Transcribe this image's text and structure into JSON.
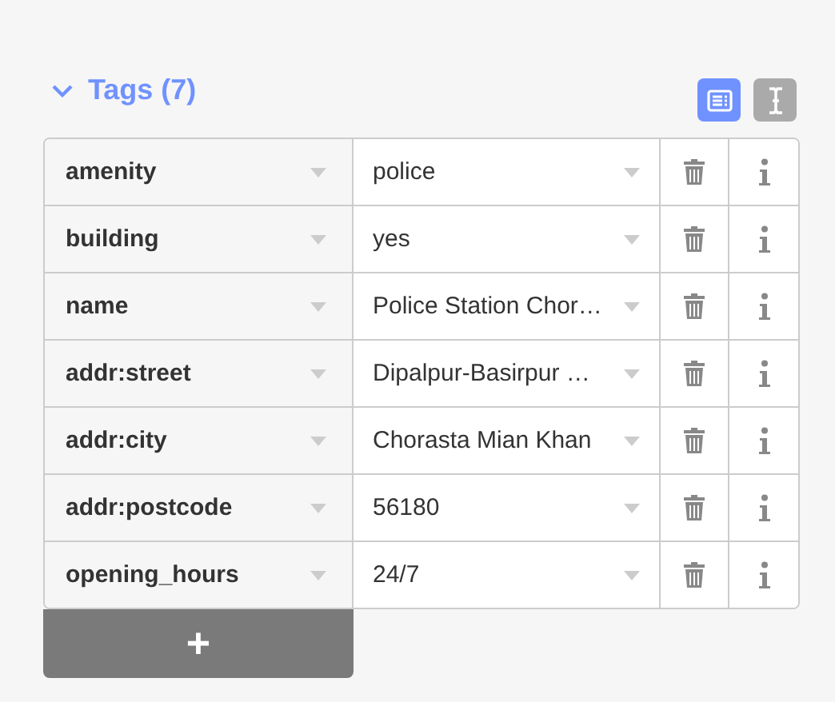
{
  "section": {
    "title": "Tags (7)",
    "expanded": true
  },
  "view_toggles": [
    {
      "kind": "list",
      "selected": true
    },
    {
      "kind": "text",
      "selected": false
    }
  ],
  "tags": [
    {
      "key": "amenity",
      "value": "police"
    },
    {
      "key": "building",
      "value": "yes"
    },
    {
      "key": "name",
      "value": "Police Station Chor…"
    },
    {
      "key": "addr:street",
      "value": "Dipalpur-Basirpur …"
    },
    {
      "key": "addr:city",
      "value": "Chorasta Mian Khan"
    },
    {
      "key": "addr:postcode",
      "value": "56180"
    },
    {
      "key": "opening_hours",
      "value": "24/7"
    }
  ],
  "add_button": "+"
}
